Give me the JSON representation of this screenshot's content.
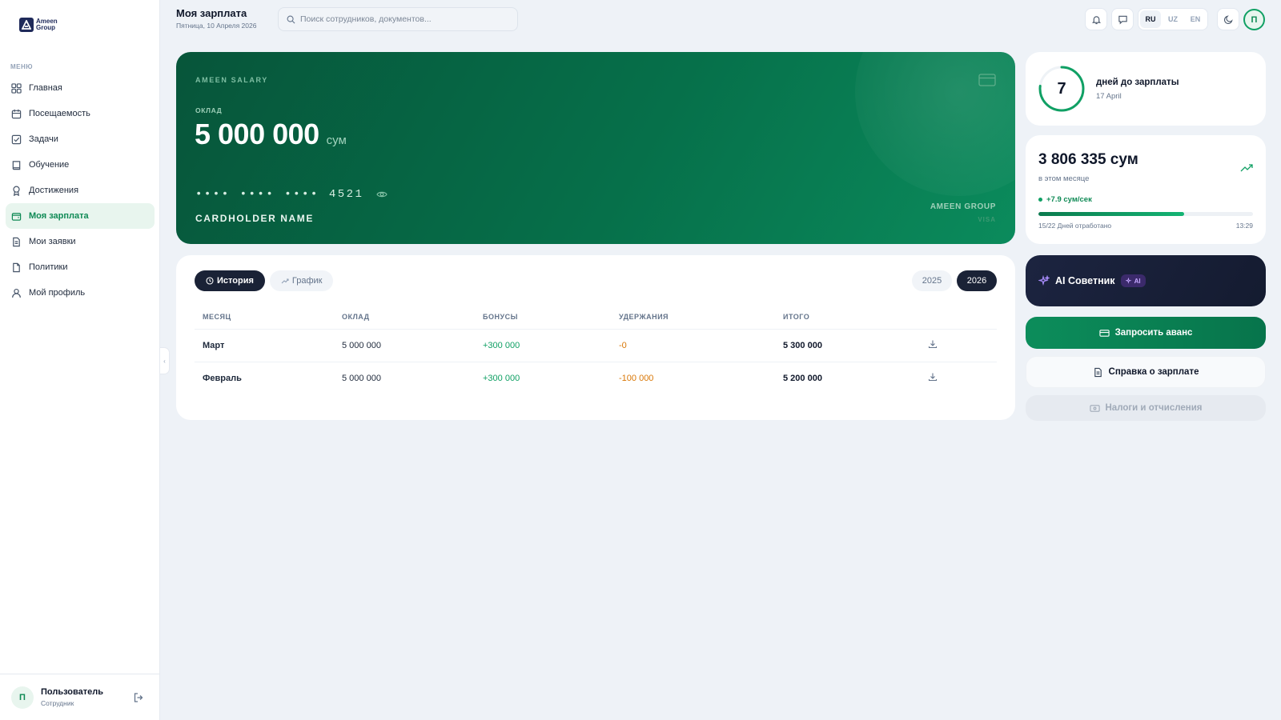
{
  "brand": {
    "name": "Ameen Group"
  },
  "sidebar": {
    "menu_title": "МЕНЮ",
    "items": [
      {
        "label": "Главная",
        "icon": "grid-icon"
      },
      {
        "label": "Посещаемость",
        "icon": "calendar-icon"
      },
      {
        "label": "Задачи",
        "icon": "checkbox-icon"
      },
      {
        "label": "Обучение",
        "icon": "book-icon"
      },
      {
        "label": "Достижения",
        "icon": "award-icon"
      },
      {
        "label": "Моя зарплата",
        "icon": "wallet-icon",
        "active": true
      },
      {
        "label": "Мои заявки",
        "icon": "file-icon"
      },
      {
        "label": "Политики",
        "icon": "document-icon"
      },
      {
        "label": "Мой профиль",
        "icon": "user-icon"
      }
    ],
    "user": {
      "initial": "П",
      "name": "Пользователь",
      "role": "Сотрудник"
    },
    "collapse_glyph": "‹"
  },
  "header": {
    "title": "Моя зарплата",
    "date": "Пятница, 10 Апреля 2026",
    "search_placeholder": "Поиск сотрудников, документов...",
    "languages": [
      "RU",
      "UZ",
      "EN"
    ],
    "active_language": "RU",
    "avatar_initial": "П"
  },
  "salary_card": {
    "brand": "AMEEN SALARY",
    "salary_label": "ОКЛАД",
    "amount": "5 000 000",
    "currency": "сум",
    "card_masked": [
      "••••",
      "••••",
      "••••",
      "4521"
    ],
    "holder": "CARDHOLDER NAME",
    "company": "AMEEN GROUP",
    "network": "VISA"
  },
  "history": {
    "tabs": [
      {
        "label": "История",
        "icon": "clock-icon",
        "active": true
      },
      {
        "label": "График",
        "icon": "trend-icon",
        "active": false
      }
    ],
    "years": [
      {
        "label": "2025",
        "active": false
      },
      {
        "label": "2026",
        "active": true
      }
    ],
    "columns": [
      "МЕСЯЦ",
      "ОКЛАД",
      "БОНУСЫ",
      "УДЕРЖАНИЯ",
      "ИТОГО"
    ],
    "rows": [
      {
        "month": "Март",
        "salary": "5 000 000",
        "bonus": "+300 000",
        "deduction": "-0",
        "total": "5 300 000"
      },
      {
        "month": "Февраль",
        "salary": "5 000 000",
        "bonus": "+300 000",
        "deduction": "-100 000",
        "total": "5 200 000"
      }
    ]
  },
  "payday": {
    "days": "7",
    "label": "дней до зарплаты",
    "date": "17 April",
    "ring_fraction": 0.77
  },
  "earned": {
    "amount": "3 806 335 сум",
    "subtitle": "в этом месяце",
    "rate": "+7.9 сум/сек",
    "progress_fraction": 0.68,
    "days_worked": "15/22 Дней отработано",
    "time": "13:29"
  },
  "ai": {
    "title": "AI Советник",
    "badge": "AI"
  },
  "actions": {
    "advance": "Запросить аванс",
    "certificate": "Справка о зарплате",
    "taxes": "Налоги и отчисления"
  },
  "colors": {
    "accent": "#10a064",
    "card_dark": "#07553a",
    "navy": "#1a2236",
    "deduction": "#d97706"
  }
}
